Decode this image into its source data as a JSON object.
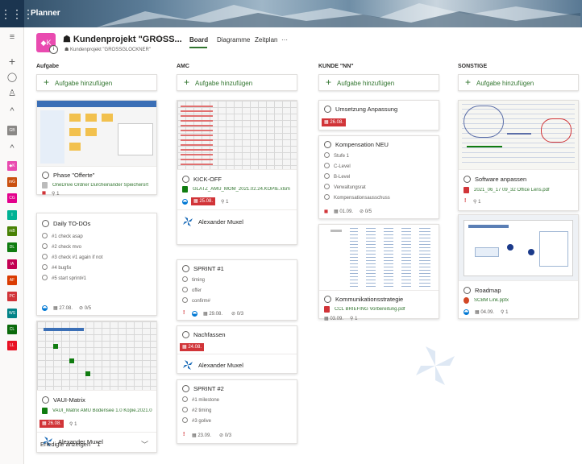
{
  "app": {
    "title": "Planner"
  },
  "plan": {
    "icon_text": "◆K",
    "title": "Kundenprojekt \"GROSS...",
    "subtitle": "Kundenprojekt \"GROSSGLOCKNER\"",
    "info": "i"
  },
  "tabs": [
    {
      "label": "Board",
      "active": true
    },
    {
      "label": "Diagramme",
      "active": false
    },
    {
      "label": "Zeitplan",
      "active": false
    },
    {
      "label": "···",
      "active": false
    }
  ],
  "rail_tiles": [
    {
      "text": "GB",
      "color": "#8a8886"
    },
    {
      "text": "◆K",
      "color": "#e94bb0"
    },
    {
      "text": "mG",
      "color": "#ca5010"
    },
    {
      "text": "CG",
      "color": "#e3008c"
    },
    {
      "text": "I",
      "color": "#00b294"
    },
    {
      "text": "mB",
      "color": "#498205"
    },
    {
      "text": "DL",
      "color": "#107c10"
    },
    {
      "text": "IA",
      "color": "#c30052"
    },
    {
      "text": "AF",
      "color": "#da3b01"
    },
    {
      "text": "PC",
      "color": "#d13438"
    },
    {
      "text": "WS",
      "color": "#038387"
    },
    {
      "text": "CL",
      "color": "#0b6a0b"
    },
    {
      "text": "LL",
      "color": "#e81123"
    }
  ],
  "add_task_label": "Aufgabe hinzufügen",
  "columns": [
    {
      "name": "Aufgabe",
      "cards": [
        {
          "title": "Phase \"Offerte\"",
          "attachment": "OneDrive Ordner Durcheinander Speicherort",
          "attach_count": "1"
        },
        {
          "title": "Daily TO-DOs",
          "items": [
            "#1 check asap",
            "#2 check mvo",
            "#3 check #1 again if not",
            "#4 bugfix",
            "#5 start sprint#1"
          ],
          "date": "27.08.",
          "checklist": "0/5"
        },
        {
          "title": "VAUI-Matrix",
          "attachment": "VAUI_Matrix AMU Bodensee 1.0 Kopie.2021.0",
          "date": "26.08.",
          "attach_count": "1",
          "assignee": "Alexander Muxel"
        }
      ]
    },
    {
      "name": "AMC",
      "cards": [
        {
          "title": "KICK-OFF",
          "attachment": "GLATZ_AMU_MOM_2021.02.24.KOPIE.xlsm",
          "date": "25.08.",
          "attach_count": "1",
          "assignee": "Alexander Muxel"
        },
        {
          "title": "SPRINT #1",
          "items": [
            "timing",
            "offer",
            "confirm#"
          ],
          "date": "29.08.",
          "checklist": "0/3"
        },
        {
          "title": "Nachfassen",
          "date": "24.08.",
          "assignee": "Alexander Muxel"
        },
        {
          "title": "SPRINT #2",
          "items": [
            "#1 milestone",
            "#2 timing",
            "#3 golive"
          ],
          "date": "23.09.",
          "checklist": "0/3"
        }
      ]
    },
    {
      "name": "KUNDE \"NN\"",
      "cards": [
        {
          "title": "Umsetzung Anpassung",
          "date": "26.08."
        },
        {
          "title": "Kompensation NEU",
          "items": [
            "Stufe 1",
            "C-Level",
            "B-Level",
            "Verwaltungsrat",
            "Kompensationsausschuss"
          ],
          "date": "01.09.",
          "checklist": "0/5"
        },
        {
          "title": "Kommunikationsstrategie",
          "attachment": "CCL BRIEFING Vorbereitung.pdf",
          "date": "03.09.",
          "attach_count": "1"
        }
      ]
    },
    {
      "name": "SONSTIGE",
      "cards": [
        {
          "title": "Software anpassen",
          "attachment": "2021_06_17 09_32 Office Lens.pdf",
          "attach_count": "1"
        },
        {
          "title": "Roadmap",
          "attachment": "SCBM Link.pptx",
          "date": "04.09.",
          "attach_count": "1"
        }
      ]
    }
  ],
  "completed": {
    "label": "Erledigte anzeigen",
    "count": "1"
  }
}
